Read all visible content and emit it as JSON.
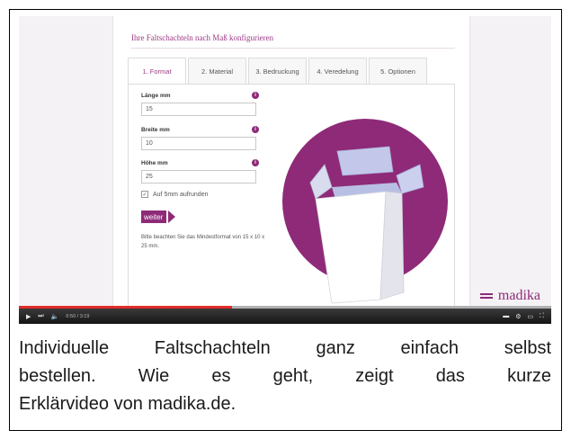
{
  "configurator": {
    "title": "Ihre Faltschachteln nach Maß konfigurieren",
    "tabs": [
      {
        "label": "1. Format",
        "active": true
      },
      {
        "label": "2. Material",
        "active": false
      },
      {
        "label": "3. Bedruckung",
        "active": false
      },
      {
        "label": "4. Veredelung",
        "active": false
      },
      {
        "label": "5. Optionen",
        "active": false
      }
    ],
    "fields": [
      {
        "label": "Länge mm",
        "value": "15"
      },
      {
        "label": "Breite mm",
        "value": "10"
      },
      {
        "label": "Höhe mm",
        "value": "25"
      }
    ],
    "info_icon": "i",
    "checkbox_label": "Auf 5mm aufrunden",
    "checkbox_mark": "✓",
    "next_button": "weiter",
    "hint": "Bitte beachten Sie das Mindestformat von 15 x 10 x 25 mm."
  },
  "brand": {
    "name": "madika",
    "color": "#8e2a78"
  },
  "player": {
    "time": "0:50 / 3:19",
    "progress": 0.4,
    "icons": [
      "play-icon",
      "next-icon",
      "volume-icon",
      "subtitles-icon",
      "settings-icon",
      "miniplayer-icon",
      "fullscreen-icon"
    ],
    "glyphs": {
      "play": "▶",
      "next": "⏭",
      "volume": "🔈",
      "subtitles": "▬",
      "settings": "⚙",
      "miniplayer": "▭",
      "fullscreen": "⛶"
    }
  },
  "caption": {
    "lines": [
      "Individuelle Faltschachteln ganz einfach selbst",
      "bestellen. Wie es geht, zeigt das kurze",
      "Erklärvideo von madika.de."
    ]
  }
}
